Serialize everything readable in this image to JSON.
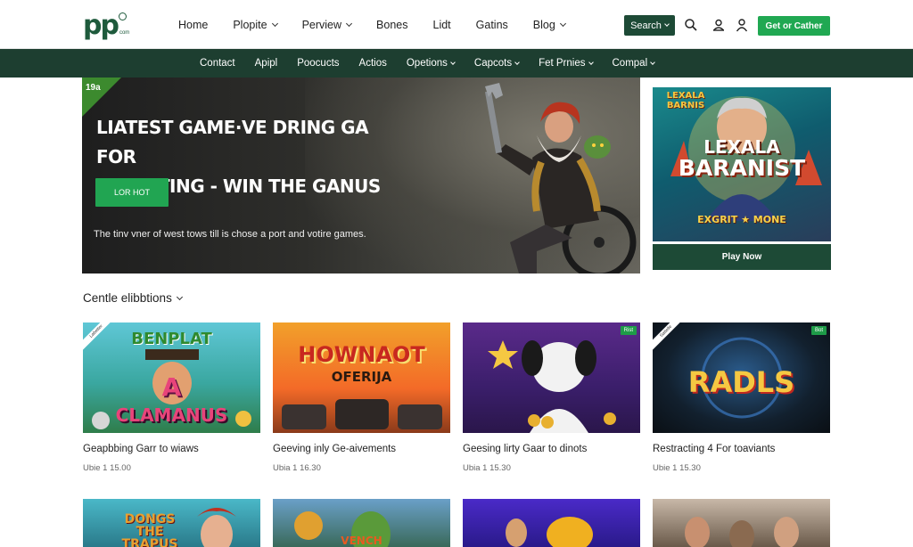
{
  "header": {
    "logo_text": "pp",
    "logo_sub": "com",
    "nav": [
      "Home",
      "Plopite",
      "Perview",
      "Bones",
      "Lidt",
      "Gatins",
      "Blog"
    ],
    "nav_has_chevron": [
      false,
      true,
      true,
      false,
      false,
      false,
      true
    ],
    "search_label": "Search",
    "cta_label": "Get or Cather"
  },
  "subnav": {
    "items": [
      "Contact",
      "Apipl",
      "Poocucts",
      "Actios",
      "Opetions",
      "Capcots",
      "Fet Prnies",
      "Compal"
    ],
    "has_chevron": [
      false,
      false,
      false,
      false,
      true,
      true,
      true,
      true
    ]
  },
  "hero": {
    "corner_label": "19a",
    "title_line1": "Liatest game·ve dring ga for",
    "title_line2": "excepting - win the ganus",
    "button_label": "LOR HOT",
    "description": "The tinv vner of west tows till is chose a port and votire games."
  },
  "promo": {
    "image_line1": "LEXALA",
    "image_line2": "BARANIST",
    "image_tag": "EXGRIT ★ MONE",
    "image_corner": "LEXALA BARNIS",
    "button_label": "Play Now"
  },
  "section": {
    "title": "Centle elibbtions"
  },
  "cards": [
    {
      "title": "Geapbbing Garr to wiaws",
      "meta": "Ubie 1 15.00",
      "img_text_top": "BENPLAT",
      "img_text_mid": "A",
      "img_text_bot": "CLAMANUS",
      "ribbon": "Labetter",
      "badge": ""
    },
    {
      "title": "Geeving inly Ge-aivements",
      "meta": "Ubia 1 16.30",
      "img_text_top": "HOWNAOT",
      "img_text_mid": "OFERIJA",
      "img_text_bot": "",
      "ribbon": "",
      "badge": ""
    },
    {
      "title": "Geesing lirty Gaar to dinots",
      "meta": "Ubia 1 15.30",
      "img_text_top": "",
      "img_text_mid": "",
      "img_text_bot": "",
      "ribbon": "",
      "badge": "Rist"
    },
    {
      "title": "Restracting 4 For toaviants",
      "meta": "Ubie 1 15.30",
      "img_text_top": "RADLS",
      "img_text_mid": "",
      "img_text_bot": "",
      "ribbon": "Sattelle",
      "badge": "Bot"
    }
  ],
  "bottom_cards": [
    {
      "img_text": "DONGS THE TRAPUS"
    },
    {
      "img_text": "VENCH"
    },
    {
      "img_text": ""
    },
    {
      "img_text": ""
    }
  ],
  "colors": {
    "brand_dark_green": "#1d3e30",
    "button_green": "#20a852",
    "search_green": "#1d4a36"
  }
}
